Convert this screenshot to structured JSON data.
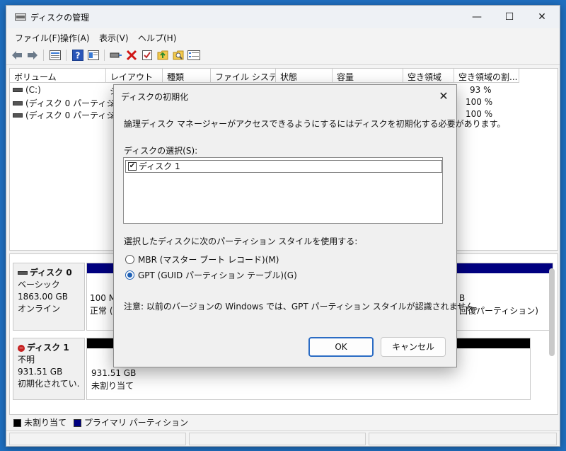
{
  "window": {
    "title": "ディスクの管理",
    "minimize": "—",
    "maximize": "☐",
    "close": "✕"
  },
  "menu": [
    "ファイル(F)",
    "操作(A)",
    "表示(V)",
    "ヘルプ(H)"
  ],
  "toolbar_icons": [
    "back-arrow-icon",
    "forward-arrow-icon",
    "list-view-icon",
    "help-icon",
    "properties-icon",
    "connect-icon",
    "delete-icon",
    "check-icon",
    "up-folder-icon",
    "search-folder-icon",
    "settings-list-icon"
  ],
  "volume_list": {
    "columns": [
      "ボリューム",
      "レイアウト",
      "種類",
      "ファイル システム",
      "状態",
      "容量",
      "空き領域",
      "空き領域の割..."
    ],
    "rows": [
      {
        "volume": "(C:)",
        "layout": "シ",
        "free_pct": "93 %"
      },
      {
        "volume": "(ディスク 0 パーティショ...",
        "layout": "シ",
        "free_pct": "100 %"
      },
      {
        "volume": "(ディスク 0 パーティショ...",
        "layout": "シ",
        "free_pct": "100 %"
      }
    ]
  },
  "disks": [
    {
      "name": "ディスク 0",
      "type": "ベーシック",
      "size": "1863.00 GB",
      "status": "オンライン",
      "part_left_size": "100 M",
      "part_left_status": "正常 (E",
      "part_right_size": "B",
      "part_right_status": "回復パーティション)"
    },
    {
      "name": "ディスク 1",
      "type": "不明",
      "size": "931.51 GB",
      "status": "初期化されてい...",
      "part_size": "931.51 GB",
      "part_status": "未割り当て"
    }
  ],
  "legend": {
    "unallocated": "未割り当て",
    "primary": "プライマリ パーティション",
    "unallocated_color": "#000000",
    "primary_color": "#000080"
  },
  "dialog": {
    "title": "ディスクの初期化",
    "close": "✕",
    "description": "論理ディスク マネージャーがアクセスできるようにするにはディスクを初期化する必要があります。",
    "select_label": "ディスクの選択(S):",
    "disk_item": "ディスク 1",
    "disk_checked": "✔",
    "style_label": "選択したディスクに次のパーティション スタイルを使用する:",
    "mbr_label": "MBR (マスター ブート レコード)(M)",
    "gpt_label": "GPT (GUID パーティション テーブル)(G)",
    "selected_style": "GPT",
    "note": "注意: 以前のバージョンの Windows では、GPT パーティション スタイルが認識されません。",
    "ok": "OK",
    "cancel": "キャンセル"
  },
  "colors": {
    "accent": "#1e5fb4",
    "primary_partition": "#000080",
    "unallocated": "#000000"
  }
}
